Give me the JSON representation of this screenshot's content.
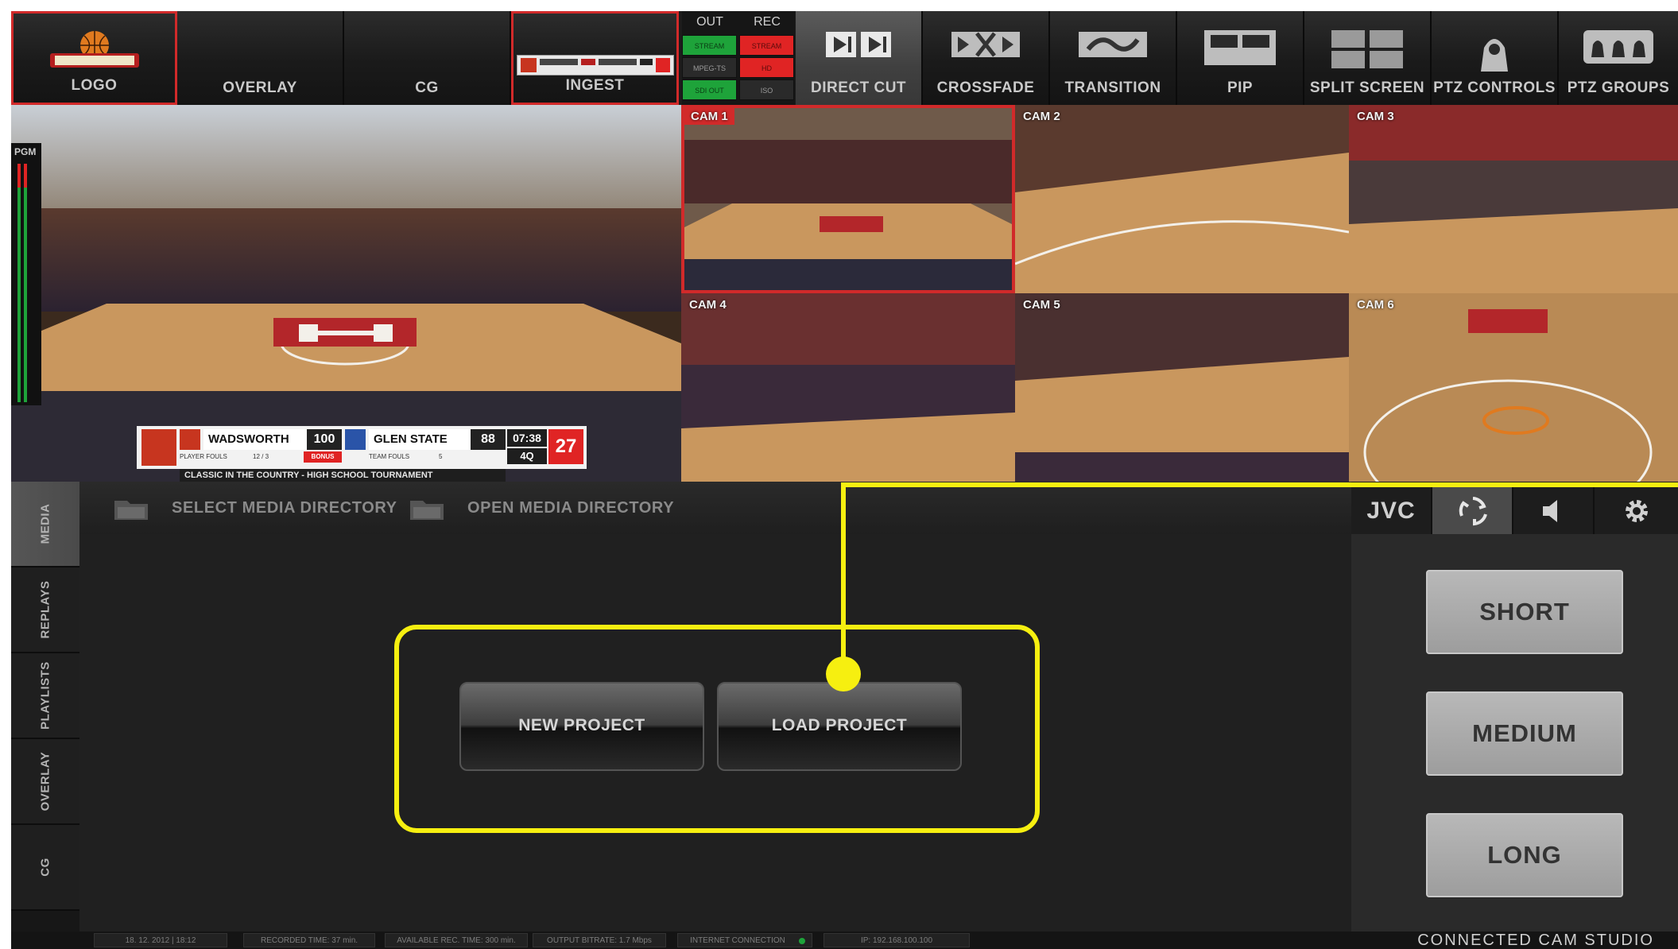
{
  "toolbar": {
    "logo": "LOGO",
    "overlay": "OVERLAY",
    "cg": "CG",
    "ingest": "INGEST",
    "direct_cut": "DIRECT CUT",
    "crossfade": "CROSSFADE",
    "transition": "TRANSITION",
    "pip": "PIP",
    "split_screen": "SPLIT SCREEN",
    "ptz_controls": "PTZ CONTROLS",
    "ptz_groups": "PTZ GROUPS"
  },
  "status_grid": {
    "out": "OUT",
    "rec": "REC",
    "out_stream": "STREAM",
    "rec_stream": "STREAM",
    "out_mpeg": "MPEG-TS",
    "rec_hd": "HD",
    "out_sdi": "SDI OUT",
    "rec_iso": "ISO",
    "colors": {
      "green": "#1ea33a",
      "red": "#e02424",
      "dark": "#2a2a2a"
    }
  },
  "program": {
    "label": "PGM",
    "scoreboard": {
      "home_team": "WADSWORTH",
      "home_score": "100",
      "home_sub": "PLAYER FOULS",
      "home_sub_val": "12 / 3",
      "bonus": "BONUS",
      "away_team": "GLEN STATE",
      "away_score": "88",
      "away_sub": "TEAM FOULS",
      "away_sub_val": "5",
      "clock": "07:38",
      "period": "4Q",
      "shot_clock": "27",
      "banner": "CLASSIC IN THE COUNTRY - HIGH SCHOOL TOURNAMENT"
    }
  },
  "cameras": [
    {
      "label": "CAM 1",
      "selected": true
    },
    {
      "label": "CAM 2",
      "selected": false
    },
    {
      "label": "CAM 3",
      "selected": false
    },
    {
      "label": "CAM 4",
      "selected": false
    },
    {
      "label": "CAM 5",
      "selected": false
    },
    {
      "label": "CAM 6",
      "selected": false
    }
  ],
  "left_tabs": [
    "MEDIA",
    "REPLAYS",
    "PLAYLISTS",
    "OVERLAY",
    "CG"
  ],
  "media_bar": {
    "select_dir": "SELECT MEDIA DIRECTORY",
    "open_dir": "OPEN MEDIA DIRECTORY"
  },
  "project": {
    "new": "NEW PROJECT",
    "load": "LOAD PROJECT"
  },
  "right_panel": {
    "brand_tab": "JVC",
    "durations": [
      "SHORT",
      "MEDIUM",
      "LONG"
    ]
  },
  "status_bar": {
    "date_time": "18. 12. 2012 | 18:12",
    "recorded": "RECORDED TIME: 37 min.",
    "available": "AVAILABLE REC. TIME: 300 min.",
    "bitrate": "OUTPUT BITRATE: 1.7 Mbps",
    "internet": "INTERNET CONNECTION",
    "ip": "IP: 192.168.100.100",
    "brand": "CONNECTED CAM STUDIO"
  },
  "accent": {
    "highlight": "#f6ef10",
    "selection": "#d12a2a"
  }
}
